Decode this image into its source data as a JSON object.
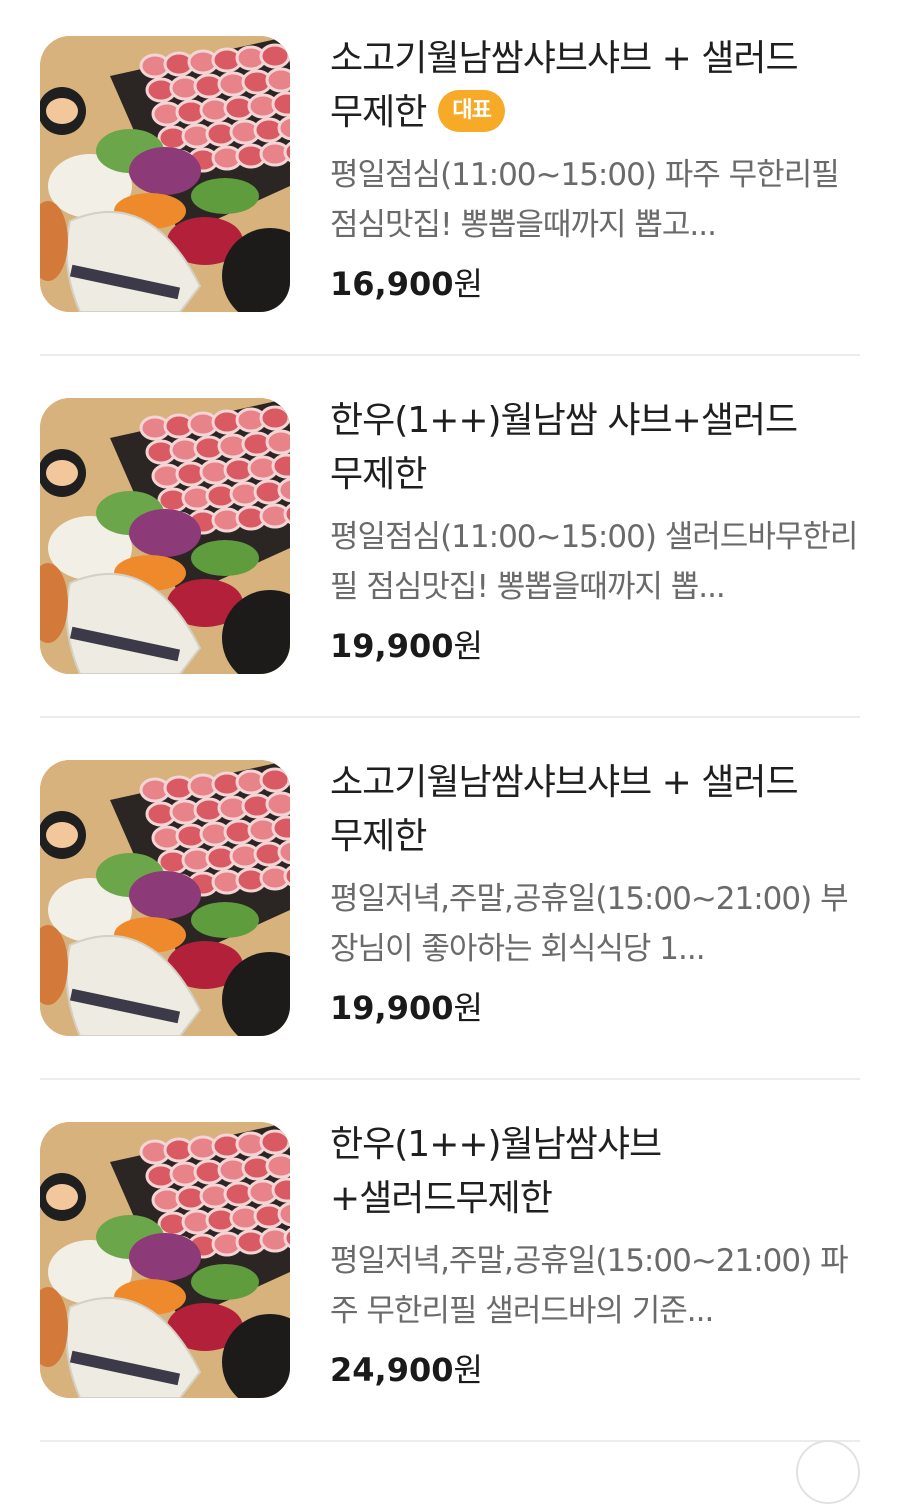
{
  "theme": {
    "badge_color": "#F7A928",
    "divider_color": "#ECECEC",
    "price_color": "#1A1A1A",
    "desc_color": "#6A6A6A"
  },
  "menu": {
    "items": [
      {
        "name": "소고기월남쌈샤브샤브 + 샐러드 무제한",
        "badge": "대표",
        "description": "평일점심(11:00~15:00) 파주 무한리필 점심맛집! 뽕뽑을때까지 뽑고...",
        "price": "16,900",
        "currency": "원",
        "image_icon": "shabu-platter-photo"
      },
      {
        "name": "한우(1++)월남쌈 샤브+샐러드 무제한",
        "badge": "",
        "description": "평일점심(11:00~15:00) 샐러드바무한리필 점심맛집! 뽕뽑을때까지 뽑...",
        "price": "19,900",
        "currency": "원",
        "image_icon": "shabu-platter-photo"
      },
      {
        "name": "소고기월남쌈샤브샤브 + 샐러드 무제한",
        "badge": "",
        "description": "평일저녁,주말,공휴일(15:00~21:00) 부장님이 좋아하는 회식식당 1...",
        "price": "19,900",
        "currency": "원",
        "image_icon": "shabu-platter-photo"
      },
      {
        "name": "한우(1++)월남쌈샤브+샐러드무제한",
        "badge": "",
        "description": "평일저녁,주말,공휴일(15:00~21:00) 파주 무한리필 샐러드바의 기준...",
        "price": "24,900",
        "currency": "원",
        "image_icon": "shabu-platter-photo"
      }
    ]
  }
}
